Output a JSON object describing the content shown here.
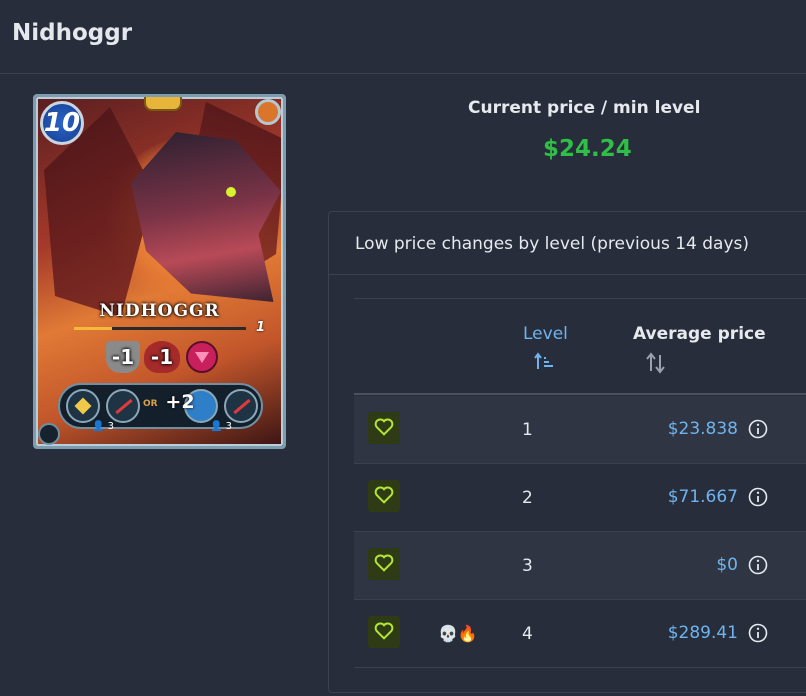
{
  "page": {
    "title": "Nidhoggr"
  },
  "card": {
    "mana": "10",
    "name": "NIDHOGGR",
    "level": "1",
    "level_progress": 0.22,
    "armor": "-1",
    "health": "-1",
    "abilities_plus": "+2",
    "or_label": "OR",
    "count_left": "3",
    "count_right": "3"
  },
  "current_price": {
    "label": "Current price / min level",
    "value": "$24.24",
    "color": "#2fbe46"
  },
  "panel": {
    "title": "Low price changes by level (previous 14 days)",
    "columns": {
      "level": "Level",
      "average_price": "Average price"
    },
    "rows": [
      {
        "level": "1",
        "price": "$23.838",
        "emoji": ""
      },
      {
        "level": "2",
        "price": "$71.667",
        "emoji": ""
      },
      {
        "level": "3",
        "price": "$0",
        "emoji": ""
      },
      {
        "level": "4",
        "price": "$289.41",
        "emoji": "💀🔥"
      }
    ]
  },
  "colors": {
    "accent_blue": "#6fb4ef",
    "heart": "#b4e633",
    "background": "#272d3a"
  }
}
